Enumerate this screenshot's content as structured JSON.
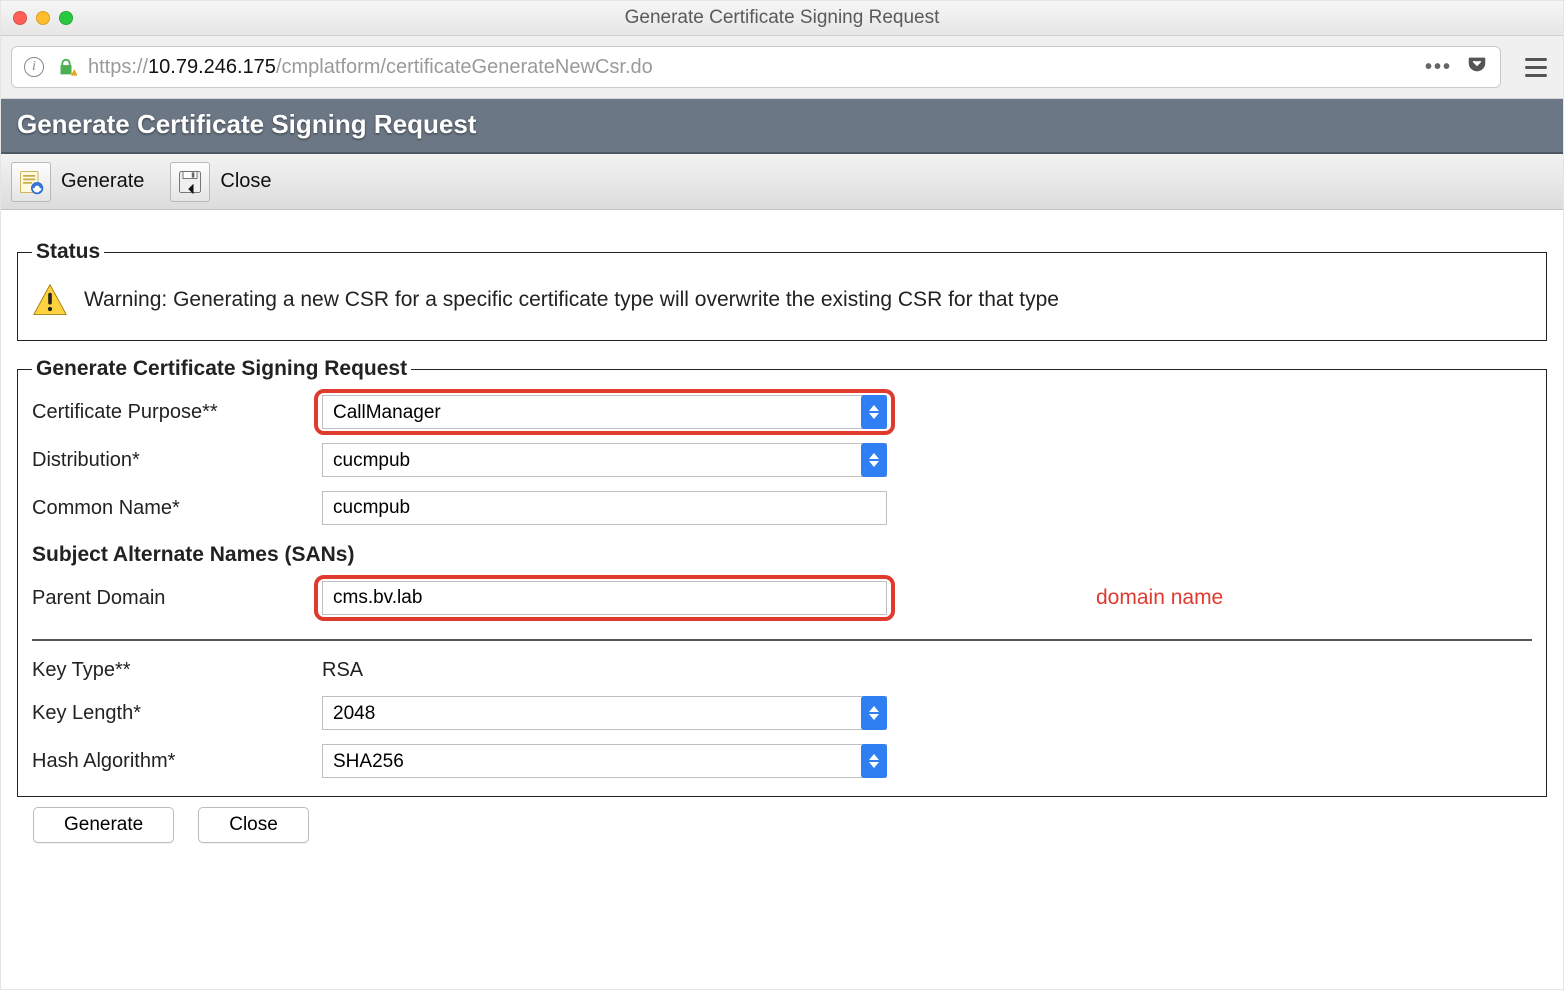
{
  "window": {
    "title": "Generate Certificate Signing Request"
  },
  "browser": {
    "url_scheme": "https://",
    "url_ip": "10.79.246.175",
    "url_path": "/cmplatform/certificateGenerateNewCsr.do",
    "menu_dots": "•••"
  },
  "header": {
    "title": "Generate Certificate Signing Request"
  },
  "toolbar": {
    "generate_label": "Generate",
    "close_label": "Close"
  },
  "status": {
    "legend": "Status",
    "warning_text": "Warning: Generating a new CSR for a specific certificate type will overwrite the existing CSR for that type"
  },
  "form": {
    "legend": "Generate Certificate Signing Request",
    "fields": {
      "cert_purpose": {
        "label": "Certificate Purpose**",
        "value": "CallManager"
      },
      "distribution": {
        "label": "Distribution*",
        "value": "cucmpub"
      },
      "common_name": {
        "label": "Common Name*",
        "value": "cucmpub"
      },
      "sans_heading": "Subject Alternate Names (SANs)",
      "parent_domain": {
        "label": "Parent Domain",
        "value": "cms.bv.lab"
      },
      "key_type": {
        "label": "Key Type**",
        "value": "RSA"
      },
      "key_length": {
        "label": "Key Length*",
        "value": "2048"
      },
      "hash_alg": {
        "label": "Hash Algorithm*",
        "value": "SHA256"
      }
    },
    "annotation": "domain name"
  },
  "footer": {
    "generate": "Generate",
    "close": "Close"
  }
}
